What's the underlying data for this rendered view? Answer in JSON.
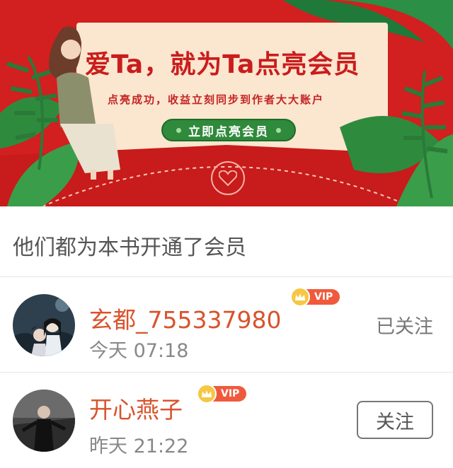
{
  "banner": {
    "title": "爱Ta，就为Ta点亮会员",
    "subtitle": "点亮成功，收益立刻同步到作者大大账户",
    "cta_label": "立即点亮会员",
    "accent_color": "#d21f1f",
    "button_color": "#2f8a3b"
  },
  "section": {
    "title": "他们都为本书开通了会员"
  },
  "members": [
    {
      "name": "玄都_755337980",
      "vip_label": "VIP",
      "time": "今天 07:18",
      "follow_label": "已关注"
    },
    {
      "name": "开心燕子",
      "vip_label": "VIP",
      "time": "昨天 21:22",
      "follow_label": "关注"
    }
  ]
}
